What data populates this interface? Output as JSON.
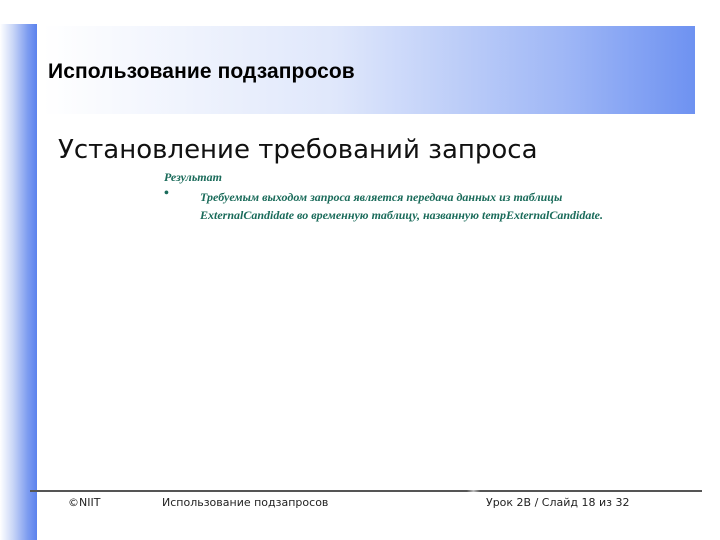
{
  "slide": {
    "title": "Использование подзапросов",
    "subtitle": "Установление требований запроса",
    "result_label": "Результат",
    "bullet_symbol": "•",
    "bullet_line1": "Требуемым выходом запроса является передача данных из таблицы",
    "bullet_line2": "ExternalCandidate во временную таблицу, названную tempExternalCandidate."
  },
  "footer": {
    "copyright": "©NIIT",
    "topic": "Использование подзапросов",
    "slide_info": "Урок 2В / Слайд 18 из 32"
  },
  "colors": {
    "accent_text": "#1a6b5a",
    "band_blue": "#6e92f1"
  }
}
